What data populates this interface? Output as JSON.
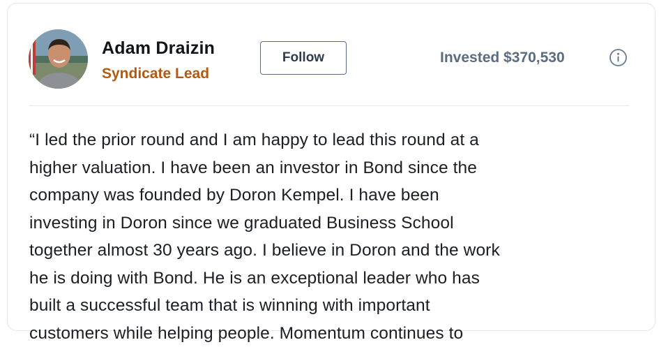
{
  "lead": {
    "name": "Adam Draizin",
    "role": "Syndicate Lead",
    "follow_label": "Follow",
    "invested_text": "Invested $370,530"
  },
  "icons": {
    "avatar": "user-avatar-photo",
    "info": "info-circle-icon"
  },
  "colors": {
    "role": "#b25a12",
    "invested": "#5b6b80",
    "button_border": "#5a6c85"
  },
  "quote_lines": [
    "“I led the prior round and I am happy to lead this round at a",
    "higher valuation. I have been an investor in Bond since the",
    "company was founded by Doron Kempel. I have been",
    "investing in Doron since we graduated Business School",
    "together almost 30 years ago. I believe in Doron and the work",
    "he is doing with Bond. He is an exceptional leader who has",
    "built a successful team that is winning with important",
    "customers while helping people. Momentum continues to"
  ]
}
